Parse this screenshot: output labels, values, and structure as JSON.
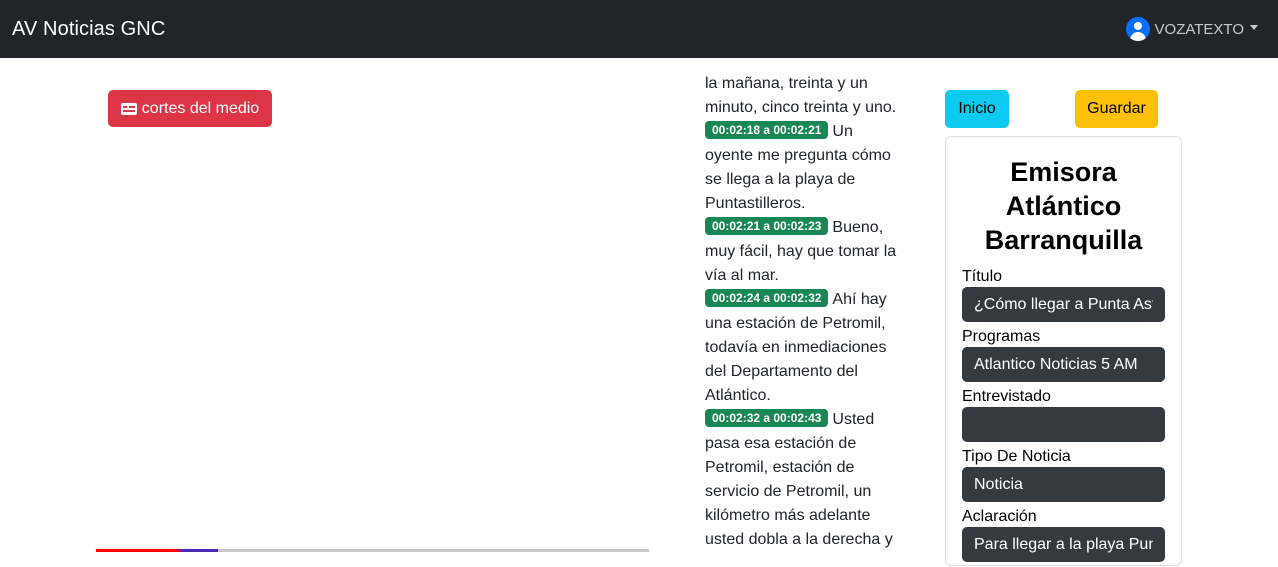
{
  "navbar": {
    "brand": "AV Noticias GNC",
    "user": "VOZATEXTO"
  },
  "media": {
    "cortes_label": "cortes del medio",
    "progress_fraction": 0.15
  },
  "transcript": {
    "lead_text": "la mañana, treinta y un minuto, cinco treinta y uno.",
    "segments": [
      {
        "time": "00:02:18 a 00:02:21",
        "text": "Un oyente me pregunta cómo se llega a la playa de Puntastilleros."
      },
      {
        "time": "00:02:21 a 00:02:23",
        "text": "Bueno, muy fácil, hay que tomar la vía al mar."
      },
      {
        "time": "00:02:24 a 00:02:32",
        "text": "Ahí hay una estación de Petromil, todavía en inmediaciones del Departamento del Atlántico."
      },
      {
        "time": "00:02:32 a 00:02:43",
        "text": "Usted pasa esa estación de Petromil, estación de servicio de Petromil, un kilómetro más adelante usted dobla a la derecha y"
      }
    ]
  },
  "actions": {
    "inicio": "Inicio",
    "guardar": "Guardar"
  },
  "form": {
    "title": "Emisora Atlántico Barranquilla",
    "fields": {
      "titulo": {
        "label": "Título",
        "value": "¿Cómo llegar a Punta Astilleros?"
      },
      "programas": {
        "label": "Programas",
        "value": "Atlantico Noticias 5 AM"
      },
      "entrevistado": {
        "label": "Entrevistado",
        "value": ""
      },
      "tipo": {
        "label": "Tipo De Noticia",
        "value": "Noticia"
      },
      "aclaracion": {
        "label": "Aclaración",
        "value": "Para llegar a la playa Punta Astilleros"
      }
    }
  }
}
